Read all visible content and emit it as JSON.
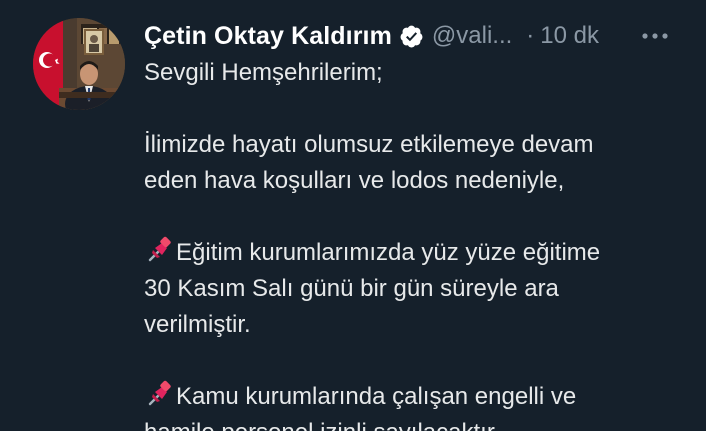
{
  "tweet": {
    "display_name": "Çetin Oktay Kaldırım",
    "handle": "@vali...",
    "separator": "·",
    "time": "10 dk",
    "more_icon": "more-horizontal-icon",
    "verified_icon": "verified-badge-icon",
    "lines": {
      "l1": "Sevgili Hemşehrilerim;",
      "l2": "İlimizde hayatı olumsuz etkilemeye devam",
      "l3": "eden hava koşulları ve lodos nedeniyle,",
      "l4": "Eğitim kurumlarımızda yüz yüze eğitime",
      "l5": "30 Kasım Salı günü bir gün süreyle ara",
      "l6": "verilmiştir.",
      "l7": "Kamu kurumlarında çalışan engelli ve",
      "l8": "hamile personel izinli sayılacaktır..."
    }
  },
  "colors": {
    "background": "#15202b",
    "text": "#e7e9ea",
    "muted": "#8b98a5",
    "verified": "#ffffff",
    "pin": "#e0245e"
  }
}
